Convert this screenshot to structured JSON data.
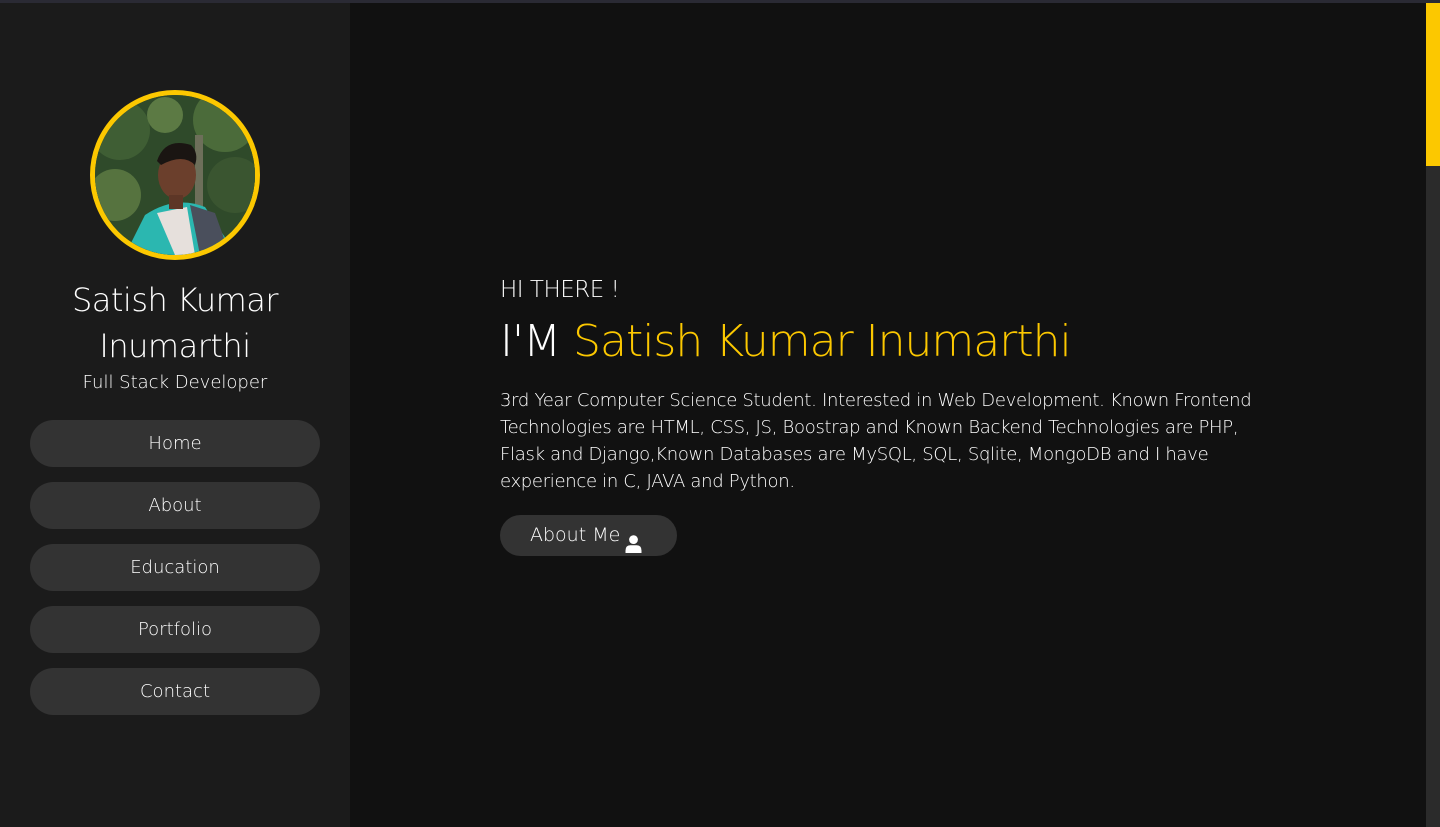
{
  "profile": {
    "name": "Satish Kumar Inumarthi",
    "role": "Full Stack Developer"
  },
  "nav": {
    "items": [
      {
        "label": "Home"
      },
      {
        "label": "About"
      },
      {
        "label": "Education"
      },
      {
        "label": "Portfolio"
      },
      {
        "label": "Contact"
      }
    ]
  },
  "hero": {
    "greeting": "HI THERE !",
    "prefix": "I'M",
    "name": "Satish Kumar Inumarthi",
    "description": "3rd Year Computer Science Student. Interested in Web Development. Known Frontend Technologies are HTML, CSS, JS, Boostrap and Known Backend Technologies are PHP, Flask and Django,Known Databases are MySQL, SQL, Sqlite, MongoDB and I have experience in C, JAVA and Python.",
    "button_label": "About Me",
    "button_icon": "user-icon"
  },
  "colors": {
    "accent": "#fcc800",
    "sidebar_bg": "#1b1b1b",
    "main_bg": "#111111",
    "button_bg": "#333333"
  }
}
